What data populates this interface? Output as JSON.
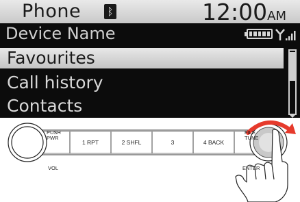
{
  "screen": {
    "title": "Phone",
    "bluetooth_icon": "bluetooth-icon",
    "clock": "12:00",
    "clock_suffix": "AM",
    "device_name": "Device Name",
    "battery_icon": "battery-icon",
    "signal_icon": "signal-strength-icon",
    "menu": [
      {
        "label": "Favourites",
        "selected": true
      },
      {
        "label": "Call history",
        "selected": false
      },
      {
        "label": "Contacts",
        "selected": false
      }
    ]
  },
  "panel": {
    "power_knob": {
      "top_label": "PUSH\nPWR",
      "bottom_label": "VOL"
    },
    "presets": [
      "1 RPT",
      "2 SHFL",
      "3",
      "4 BACK"
    ],
    "tune_knob": {
      "top_label": "FILE\nTUNE",
      "bottom_label": "ENTER"
    },
    "rotate_icon": "rotate-clockwise-arrow-icon",
    "hand_icon": "pointing-hand-icon"
  },
  "colors": {
    "screen_bg": "#0c0c0c",
    "highlight": "#d9d9d9",
    "text_on_screen": "#d8d8d8",
    "rotate_arrow": "#e63a2c"
  }
}
